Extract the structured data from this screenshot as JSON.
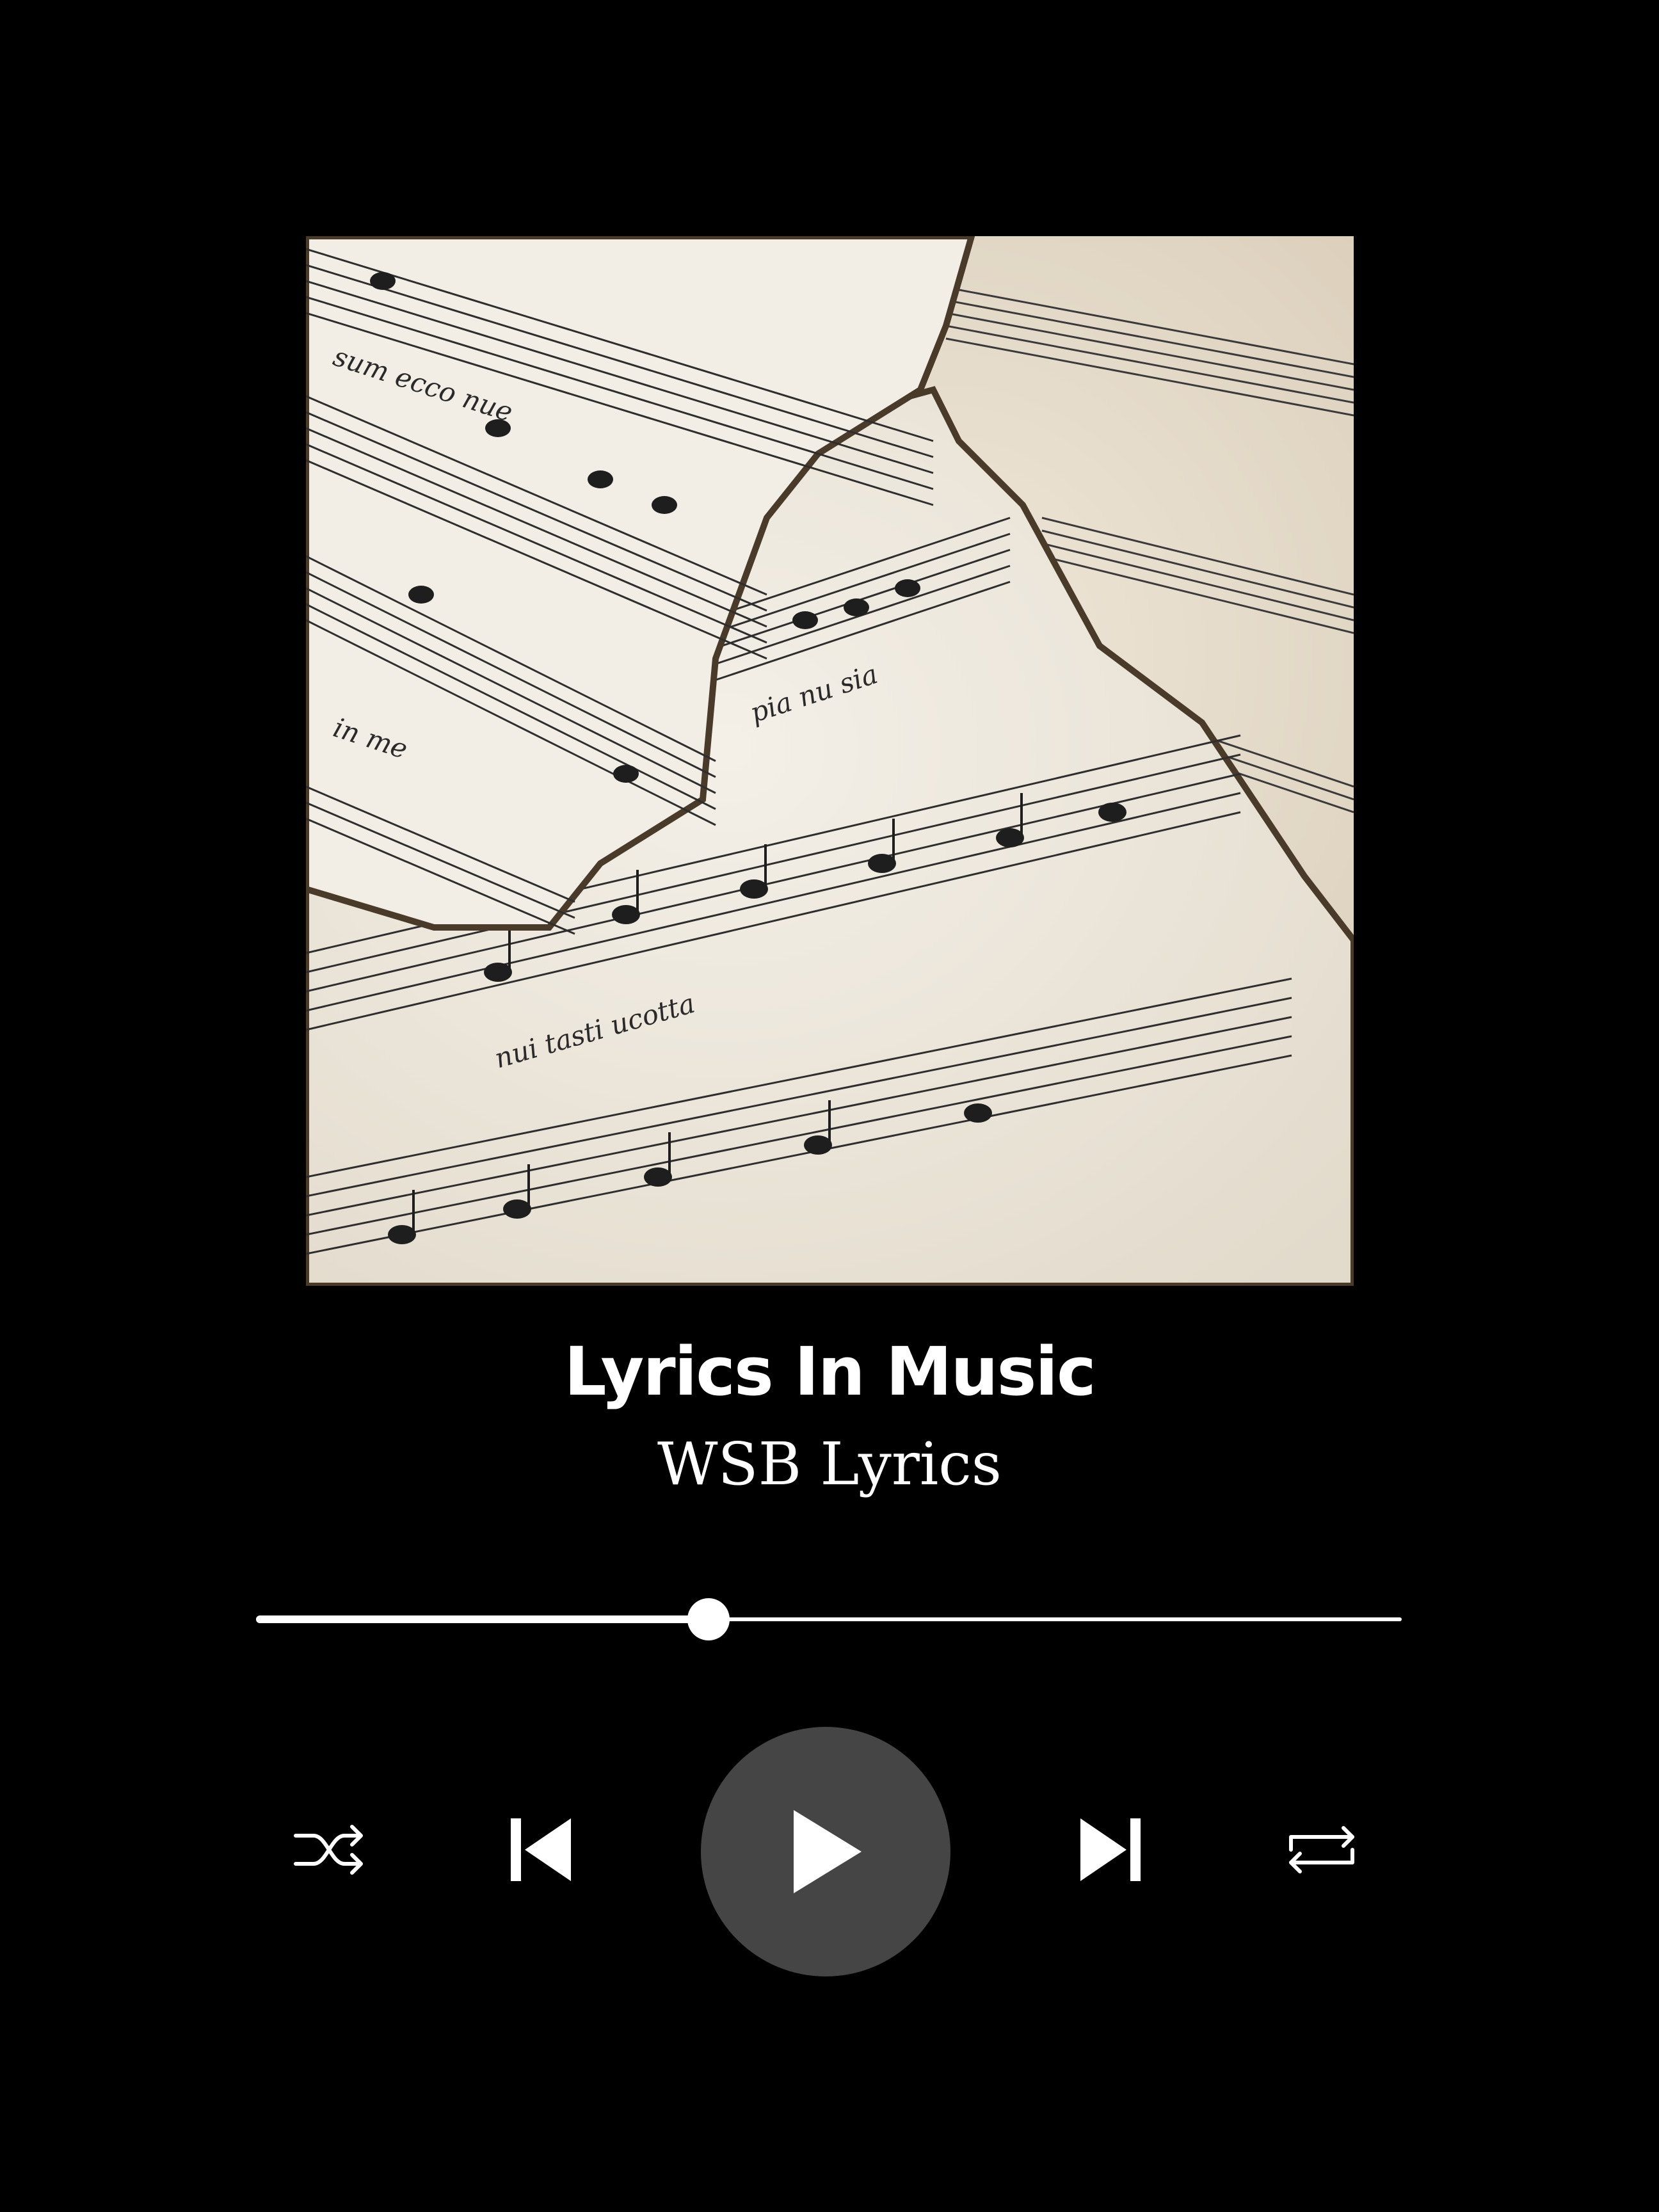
{
  "album_art": {
    "icon": "sheet-music-album-art"
  },
  "track": {
    "title": "Lyrics In Music",
    "artist": "WSB Lyrics"
  },
  "progress": {
    "fraction": 0.395
  },
  "controls": {
    "shuffle_icon": "shuffle-icon",
    "previous_icon": "skip-previous-icon",
    "play_icon": "play-icon",
    "next_icon": "skip-next-icon",
    "repeat_icon": "repeat-icon"
  },
  "colors": {
    "background": "#000000",
    "text": "#ffffff",
    "play_button": "#454545"
  }
}
